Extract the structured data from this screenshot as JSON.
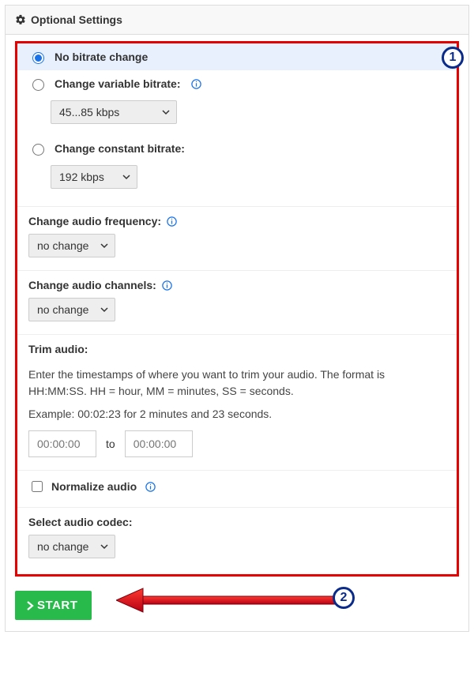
{
  "panel": {
    "title": "Optional Settings"
  },
  "bitrate": {
    "no_change_label": "No bitrate change",
    "variable_label": "Change variable bitrate:",
    "variable_value": "45...85 kbps",
    "constant_label": "Change constant bitrate:",
    "constant_value": "192 kbps"
  },
  "frequency": {
    "label": "Change audio frequency:",
    "value": "no change"
  },
  "channels": {
    "label": "Change audio channels:",
    "value": "no change"
  },
  "trim": {
    "label": "Trim audio:",
    "help1": "Enter the timestamps of where you want to trim your audio. The format is HH:MM:SS. HH = hour, MM = minutes, SS = seconds.",
    "help2": "Example: 00:02:23 for 2 minutes and 23 seconds.",
    "from_placeholder": "00:00:00",
    "to_label": "to",
    "to_placeholder": "00:00:00"
  },
  "normalize": {
    "label": "Normalize audio"
  },
  "codec": {
    "label": "Select audio codec:",
    "value": "no change"
  },
  "start_button": "START",
  "badges": {
    "one": "1",
    "two": "2"
  }
}
